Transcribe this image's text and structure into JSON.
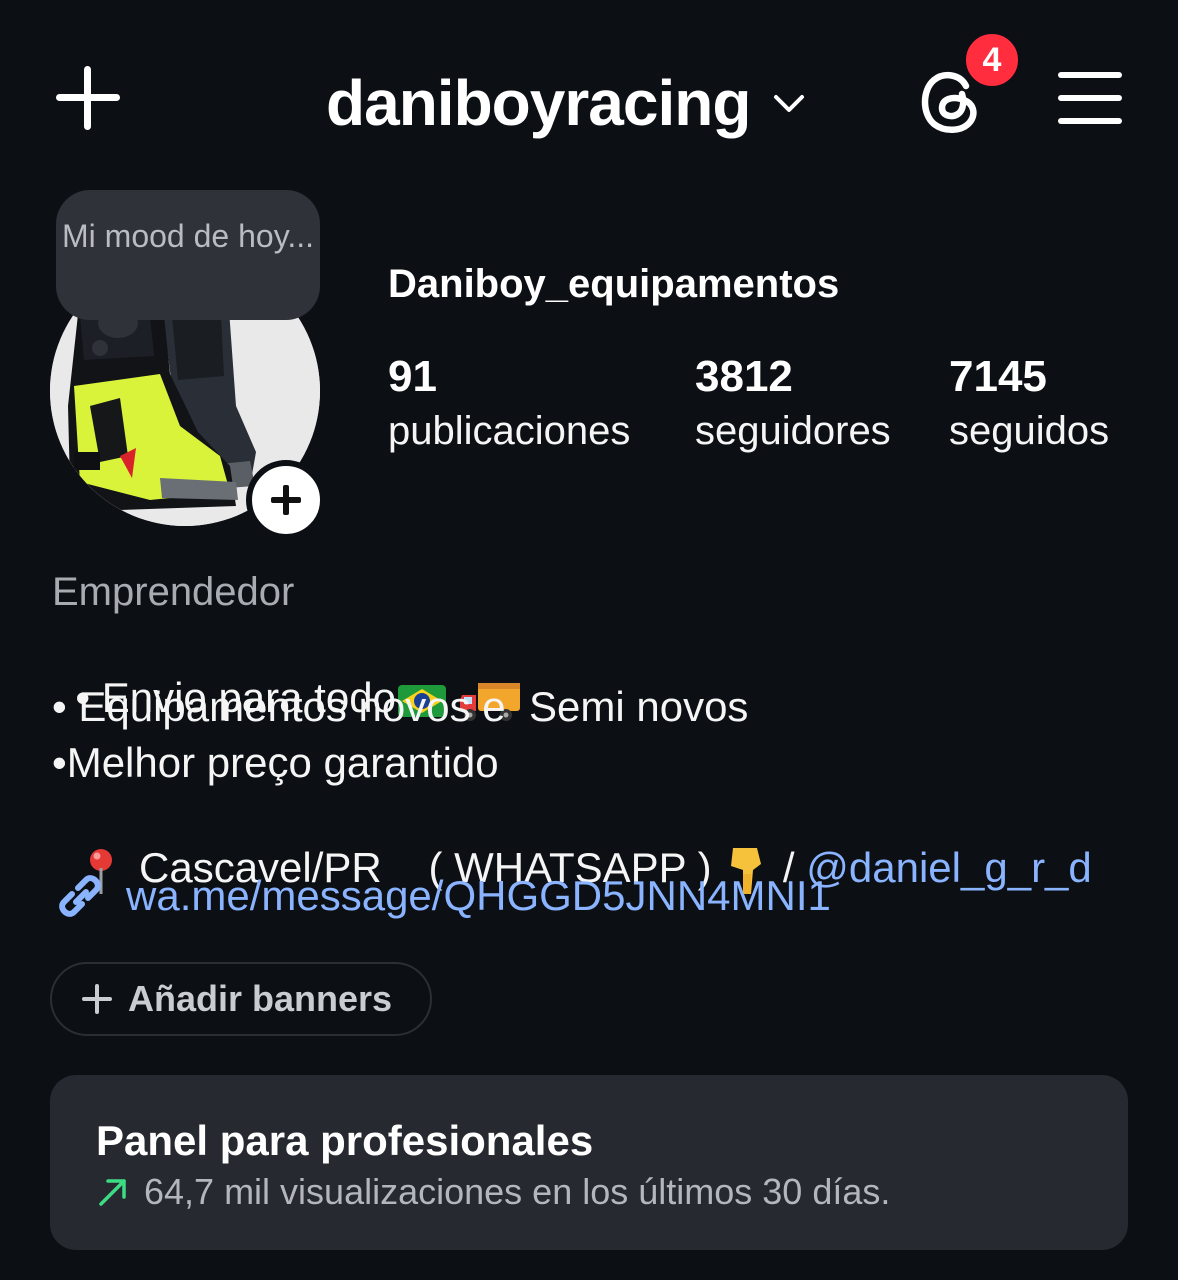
{
  "header": {
    "username": "daniboyracing",
    "notification_count": "4"
  },
  "profile": {
    "note": "Mi mood de hoy...",
    "display_name": "Daniboy_equipamentos",
    "stats": [
      {
        "value": "91",
        "label": "publicaciones"
      },
      {
        "value": "3812",
        "label": "seguidores"
      },
      {
        "value": "7145",
        "label": "seguidos"
      }
    ]
  },
  "bio": {
    "category": "Emprendedor",
    "line1": "• Envio para todo",
    "line2": "• Equipamentos novos e  Semi novos",
    "line3": "•Melhor preço garantido",
    "line4_text": " Cascavel/PR    ( WHATSAPP ) ",
    "line4_sep": " / ",
    "mention": "@daniel_g_r_d",
    "link": "wa.me/message/QHGGD5JNN4MNI1"
  },
  "banners": {
    "label": "Añadir banners"
  },
  "pro_panel": {
    "title": "Panel para profesionales",
    "subtitle": "64,7 mil visualizaciones en los últimos 30 días."
  },
  "colors": {
    "background": "#0c0f14",
    "badge": "#ff2d3d",
    "link": "#8ab4ff",
    "trend_up": "#3ddc84"
  },
  "icons": [
    "plus-icon",
    "chevron-down-icon",
    "threads-icon",
    "menu-icon",
    "add-story-icon",
    "brazil-flag-icon",
    "truck-icon",
    "pin-icon",
    "pointing-down-icon",
    "link-icon",
    "trend-up-icon"
  ]
}
